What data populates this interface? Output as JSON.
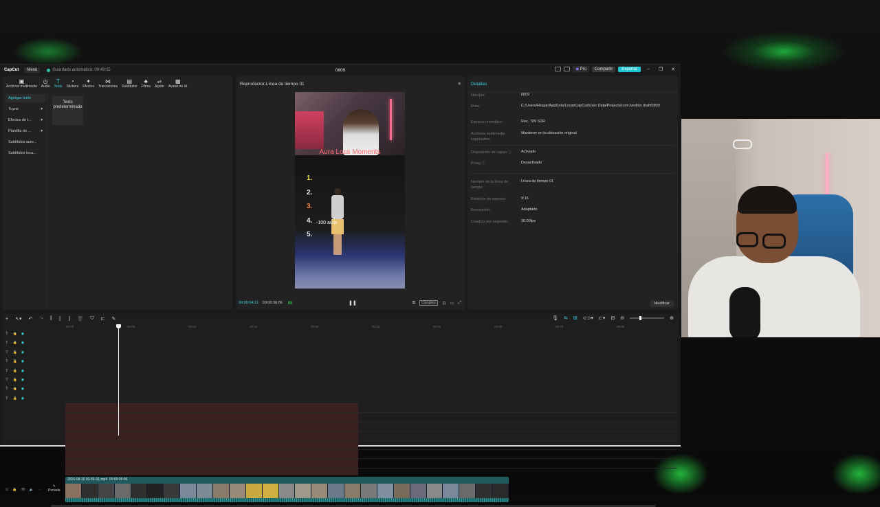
{
  "app": {
    "logo": "CapCut",
    "menu_label": "Menú",
    "autosave": "Guardado automático: 09:49:35",
    "project_title": "0809",
    "pro_label": "Pro",
    "share_label": "Compartir",
    "export_label": "Exportar"
  },
  "toolbar": {
    "tabs": [
      {
        "icon": "▣",
        "label": "Archivos multimedia"
      },
      {
        "icon": "◷",
        "label": "Audio"
      },
      {
        "icon": "T",
        "label": "Texto"
      },
      {
        "icon": "◔",
        "label": "Stickers"
      },
      {
        "icon": "✦",
        "label": "Efectos"
      },
      {
        "icon": "⋈",
        "label": "Transiciones"
      },
      {
        "icon": "▤",
        "label": "Subtítulos"
      },
      {
        "icon": "♣",
        "label": "Filtros"
      },
      {
        "icon": "⇌",
        "label": "Ajuste"
      },
      {
        "icon": "▦",
        "label": "Avatar de IA"
      }
    ]
  },
  "sidebar": {
    "items": [
      {
        "label": "Agregar texto",
        "arrow": ""
      },
      {
        "label": "Tuyos",
        "arrow": "▾"
      },
      {
        "label": "Efectos de t...",
        "arrow": "▾"
      },
      {
        "label": "Plantilla de ...",
        "arrow": "▾"
      },
      {
        "label": "Subtítulos auto...",
        "arrow": ""
      },
      {
        "label": "Subtítulos loca...",
        "arrow": ""
      }
    ]
  },
  "text_card": "Texto predeterminado",
  "player": {
    "title": "Reproductor-Línea de tiempo 01",
    "video_title": "Aura Loss Moments",
    "list_numbers": [
      "1.",
      "2.",
      "3.",
      "4.",
      "5."
    ],
    "list_colors": [
      "#f5e14a",
      "#f0f0f0",
      "#f08a3a",
      "#f0f0f0",
      "#f0f0f0"
    ],
    "aura_text": "-100 aura",
    "current_time": "00:00:04:11",
    "total_time": "00:00:36:06",
    "complete_label": "Completo"
  },
  "details": {
    "header": "Detalles",
    "rows": [
      {
        "label": "Nombre:",
        "value": "0809"
      },
      {
        "label": "Ruta:",
        "value": "C:/Users/Hiogar/AppData/Local/CapCut/User Data/Projects/com.lveditor.draft/0809"
      },
      {
        "label": "Espacio cromático:",
        "value": "Rec. 709 SDR"
      },
      {
        "label": "Archivos multimedia importados:",
        "value": "Mantener en la ubicación original"
      },
      {
        "label": "Disposición de capas ⓘ",
        "value": "Activado"
      },
      {
        "label": "Proxy ⓘ",
        "value": "Desactivado"
      },
      {
        "label": "Nombre de la línea de tiempo:",
        "value": "Línea de tiempo 01"
      },
      {
        "label": "Relación de aspecto:",
        "value": "9:16"
      },
      {
        "label": "Resolución:",
        "value": "Adaptado"
      },
      {
        "label": "Cuadros por segundo:",
        "value": "30.00fps"
      }
    ],
    "modify_label": "Modificar"
  },
  "timeline": {
    "ruler": [
      "00:00",
      "00:05",
      "00:10",
      "00:15",
      "00:20",
      "00:25",
      "00:30",
      "00:35",
      "00:40",
      "00:45"
    ],
    "main_clip_label": "2026-08-10 03-56-31.mp4",
    "main_clip_duration": "00:00:36:06",
    "cover_label": "Portada"
  }
}
